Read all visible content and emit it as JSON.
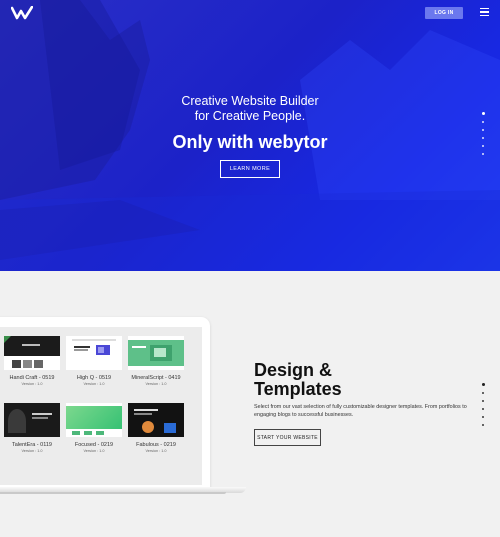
{
  "header": {
    "login_label": "LOG IN"
  },
  "hero": {
    "line1": "Creative Website Builder",
    "line2": "for Creative People.",
    "headline": "Only with webytor",
    "cta_label": "LEARN MORE"
  },
  "design": {
    "title_line1": "Design &",
    "title_line2": "Templates",
    "description": "Select from our vast selection of fully customizable designer templates. From portfolios to engaging blogs to successful businesses.",
    "cta_label": "START YOUR WEBSITE"
  },
  "templates": [
    {
      "name": "Handi Craft - 0519",
      "version": "Version : 1.0"
    },
    {
      "name": "High Q - 0519",
      "version": "Version : 1.0"
    },
    {
      "name": "MineralScript - 0419",
      "version": "Version : 1.0"
    },
    {
      "name": "TalentEra - 0119",
      "version": "Version : 1.0"
    },
    {
      "name": "Focused - 0219",
      "version": "Version : 1.0"
    },
    {
      "name": "Fabulous - 0219",
      "version": "Version : 1.0"
    }
  ],
  "icons": {
    "logo": "webytor-logo",
    "menu": "hamburger-menu-icon"
  },
  "colors": {
    "hero_blue": "#1c22c8",
    "login_bg": "#6b78ee",
    "page_bg": "#f1f1f1"
  }
}
